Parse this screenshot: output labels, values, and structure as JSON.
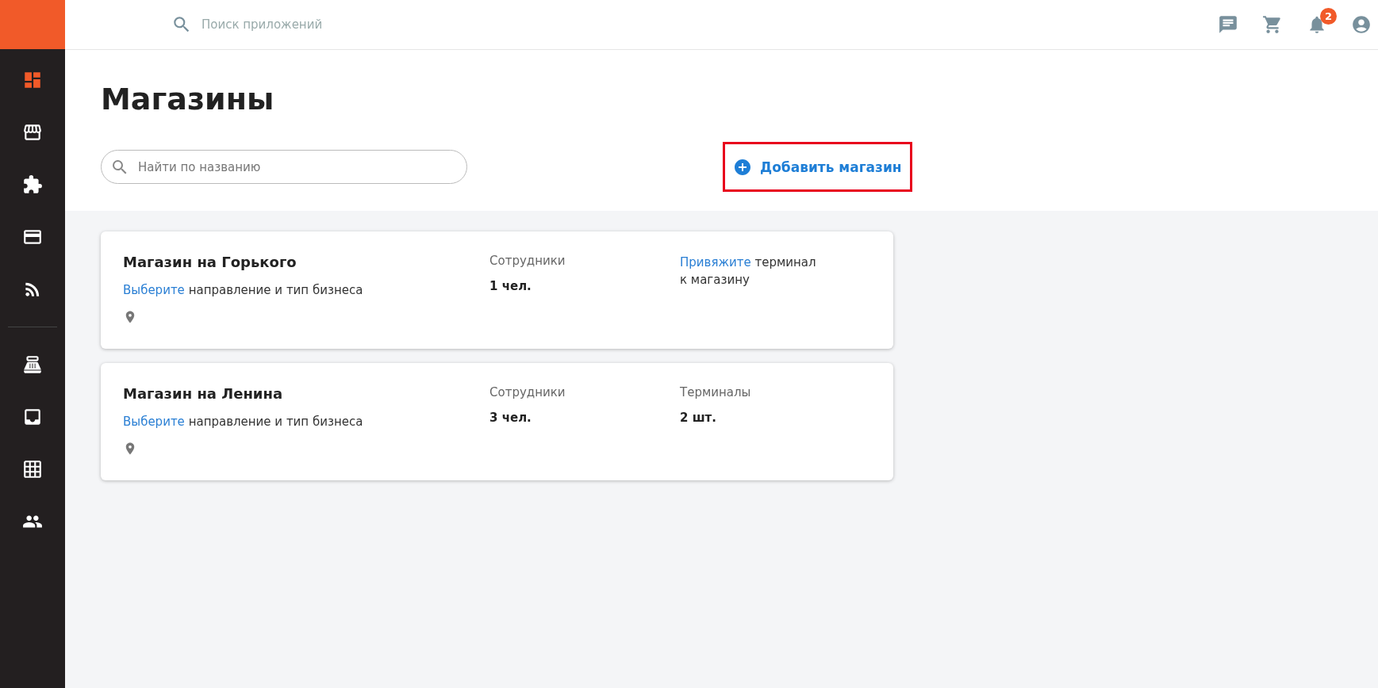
{
  "sidebar": {
    "groups": [
      {
        "items": [
          {
            "selected": true
          },
          {
            "selected": false
          },
          {
            "selected": false
          },
          {
            "selected": false
          },
          {
            "selected": false
          }
        ]
      },
      {
        "items": [
          {
            "selected": false
          },
          {
            "selected": false
          },
          {
            "selected": false
          },
          {
            "selected": false
          }
        ]
      }
    ]
  },
  "topbar": {
    "search": {
      "placeholder": "Поиск приложений"
    },
    "notifications": {
      "count": "2"
    }
  },
  "page": {
    "title": "Магазины",
    "search": {
      "placeholder": "Найти по названию"
    },
    "add_button": {
      "label": "Добавить магазин",
      "highlighted": true
    }
  },
  "stores": [
    {
      "name": "Магазин на Горького",
      "business": {
        "link": "Выберите",
        "text": "направление и тип бизнеса"
      },
      "employees": {
        "label": "Сотрудники",
        "value": "1 чел."
      },
      "terminals": {
        "kind": "prompt",
        "link": "Привяжите",
        "text": "терминал к магазину"
      }
    },
    {
      "name": "Магазин на Ленина",
      "business": {
        "link": "Выберите",
        "text": "направление и тип бизнеса"
      },
      "employees": {
        "label": "Сотрудники",
        "value": "3 чел."
      },
      "terminals": {
        "kind": "stat",
        "label": "Терминалы",
        "value": "2 шт."
      }
    }
  ]
}
